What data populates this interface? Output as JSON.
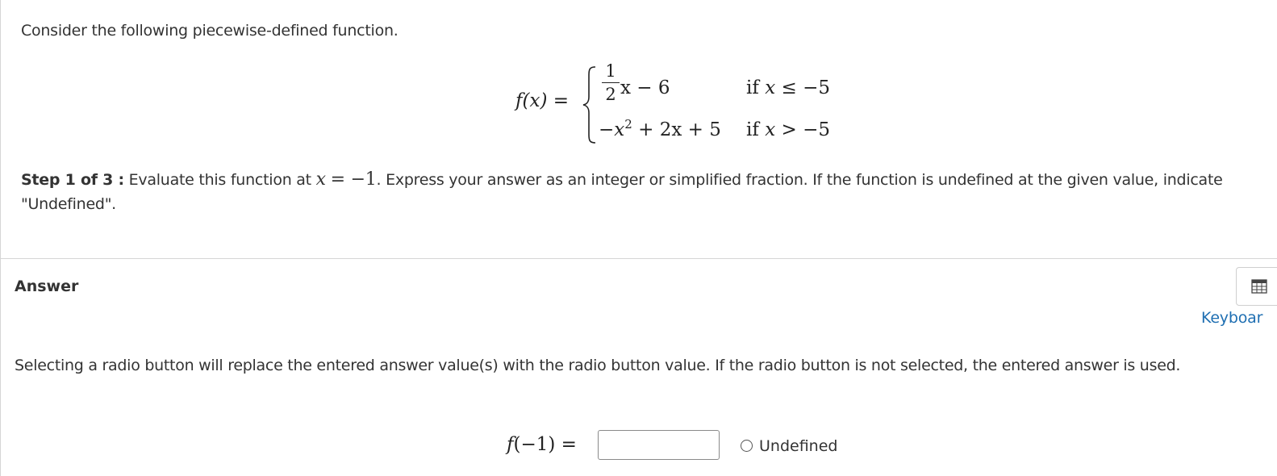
{
  "question": {
    "intro": "Consider the following piecewise-defined function.",
    "function": {
      "lhs": "f(x)",
      "equals": "=",
      "case1_fraction_num": "1",
      "case1_fraction_den": "2",
      "case1_rest": "x − 6",
      "case1_cond_if": "if",
      "case1_cond_var": "x",
      "case1_cond_op": "≤ −5",
      "case2_neg": "−",
      "case2_var": "x",
      "case2_exp": "2",
      "case2_rest": "+ 2x + 5",
      "case2_cond_if": "if",
      "case2_cond_var": "x",
      "case2_cond_op": "> −5"
    },
    "step": {
      "label": "Step 1 of 3 :",
      "text_before": "Evaluate this function at",
      "var": "x",
      "math_rest": "= −1",
      "text_after": ". Express your answer as an integer or simplified fraction. If the function is undefined at the given value, indicate \"Undefined\"."
    }
  },
  "answer": {
    "title": "Answer",
    "tool_button_icon": "table-icon",
    "keyboard_link": "Keyboar",
    "radio_note": "Selecting a radio button will replace the entered answer value(s) with the radio button value. If the radio button is not selected, the entered answer is used.",
    "f_label_f": "f",
    "f_label_rest": "(−1) =",
    "input": {
      "value": "",
      "placeholder": ""
    },
    "radio_option": {
      "label": "Undefined",
      "selected": false
    }
  },
  "colors": {
    "text": "#333333",
    "link": "#1f6fb2",
    "border": "#d6d6d6",
    "input_border": "#8a8a8a"
  }
}
